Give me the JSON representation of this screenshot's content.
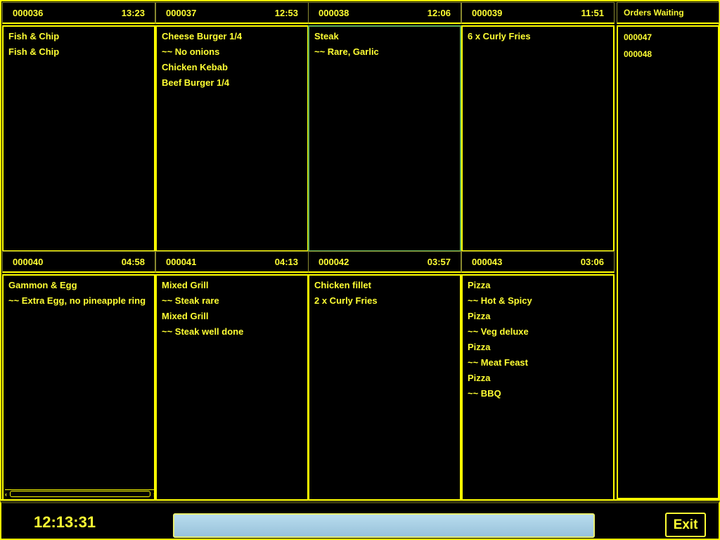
{
  "orders": [
    {
      "id": "000036",
      "time": "13:23",
      "items": [
        "Fish & Chip",
        "Fish & Chip"
      ]
    },
    {
      "id": "000037",
      "time": "12:53",
      "items": [
        "Cheese Burger 1/4",
        " ~~ No onions",
        "Chicken Kebab",
        "Beef Burger 1/4"
      ]
    },
    {
      "id": "000038",
      "time": "12:06",
      "items": [
        "Steak",
        " ~~ Rare, Garlic"
      ],
      "selected": true
    },
    {
      "id": "000039",
      "time": "11:51",
      "items": [
        "6 x Curly Fries"
      ]
    },
    {
      "id": "000040",
      "time": "04:58",
      "items": [
        "Gammon & Egg",
        " ~~ Extra Egg, no pineapple ring"
      ]
    },
    {
      "id": "000041",
      "time": "04:13",
      "items": [
        "Mixed Grill",
        " ~~ Steak rare",
        "Mixed Grill",
        " ~~ Steak well done"
      ]
    },
    {
      "id": "000042",
      "time": "03:57",
      "items": [
        "Chicken fillet",
        "2 x Curly Fries"
      ]
    },
    {
      "id": "000043",
      "time": "03:06",
      "items": [
        "Pizza",
        " ~~ Hot & Spicy",
        "Pizza",
        " ~~ Veg deluxe",
        "Pizza",
        " ~~ Meat Feast",
        "Pizza",
        " ~~ BBQ"
      ]
    }
  ],
  "waiting": {
    "title": "Orders Waiting",
    "items": [
      "000047",
      "000048"
    ]
  },
  "footer": {
    "clock": "12:13:31",
    "exit_label": "Exit",
    "progress_color": "#a8cfe4"
  },
  "colors": {
    "accent": "#ffff00",
    "selected_border": "#5fae5a"
  }
}
